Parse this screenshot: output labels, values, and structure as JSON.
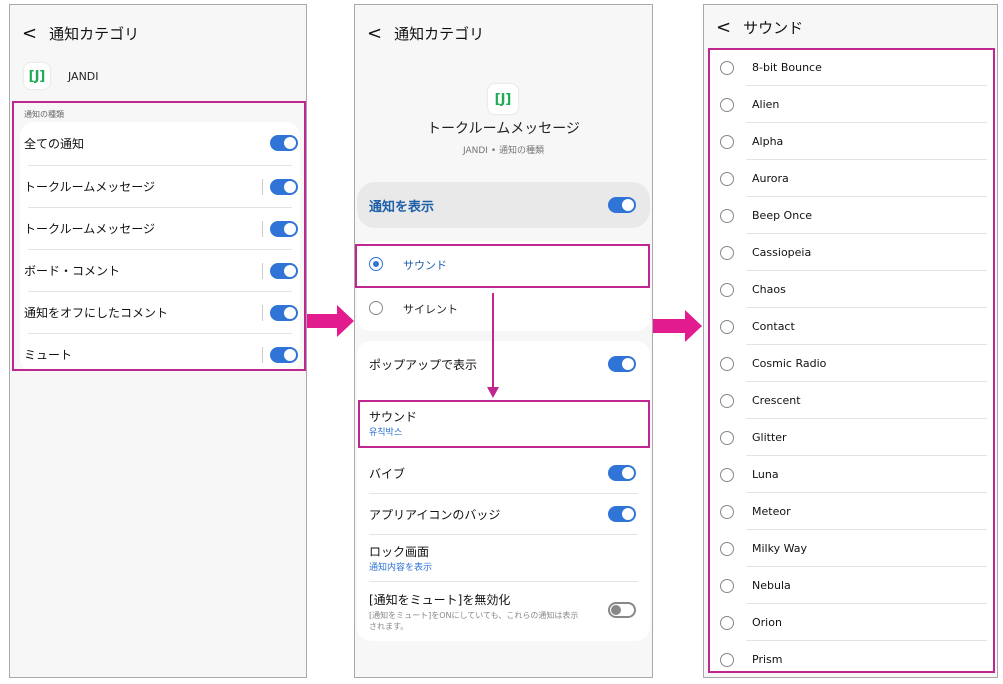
{
  "panel1": {
    "title": "通知カテゴリ",
    "app_name": "JANDI",
    "section_label": "通知の種類",
    "items": [
      "全ての通知",
      "トークルームメッセージ",
      "トークルームメッセージ",
      "ボード・コメント",
      "通知をオフにしたコメント",
      "ミュート"
    ]
  },
  "panel2": {
    "title": "通知カテゴリ",
    "channel_title": "トークルームメッセージ",
    "channel_sub": "JANDI • 通知の種類",
    "show_label": "通知を表示",
    "sound_option": "サウンド",
    "silent_option": "サイレント",
    "popup_label": "ポップアップで表示",
    "sound_label": "サウンド",
    "sound_value": "유칙박스",
    "vibe_label": "バイブ",
    "badge_label": "アプリアイコンのバッジ",
    "lock_label": "ロック画面",
    "lock_value": "通知内容を表示",
    "mute_label": "[通知をミュート]を無効化",
    "mute_desc": "[通知をミュート]をONにしていても、これらの通知は表示されます。"
  },
  "panel3": {
    "title": "サウンド",
    "sounds": [
      "8-bit Bounce",
      "Alien",
      "Alpha",
      "Aurora",
      "Beep Once",
      "Cassiopeia",
      "Chaos",
      "Contact",
      "Cosmic Radio",
      "Crescent",
      "Glitter",
      "Luna",
      "Meteor",
      "Milky Way",
      "Nebula",
      "Orion",
      "Prism"
    ]
  },
  "colors": {
    "accent": "#2f74d6",
    "highlight": "#c0268f",
    "arrow": "#e21c8e"
  }
}
